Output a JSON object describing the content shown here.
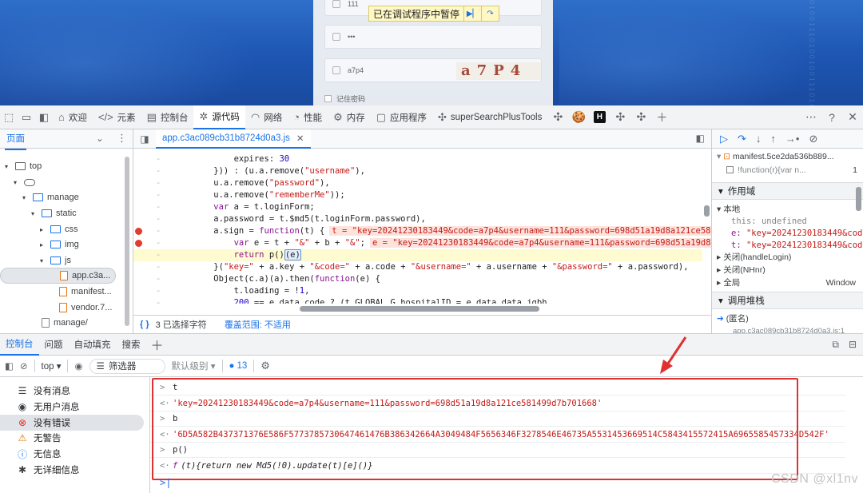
{
  "preview": {
    "username_value": "111",
    "password_value": "•••",
    "captcha_value": "a7p4",
    "captcha_image_text": "a7P4",
    "remember_label": "记住密码",
    "paused_banner": "已在调试程序中暂停"
  },
  "devtools_tabs": [
    {
      "label": "欢迎",
      "icon": "home-icon"
    },
    {
      "label": "元素",
      "icon": "code-tag-icon"
    },
    {
      "label": "控制台",
      "icon": "console-icon"
    },
    {
      "label": "源代码",
      "icon": "bug-icon",
      "active": true
    },
    {
      "label": "网络",
      "icon": "wifi-icon"
    },
    {
      "label": "性能",
      "icon": "gauge-icon"
    },
    {
      "label": "内存",
      "icon": "memory-icon"
    },
    {
      "label": "应用程序",
      "icon": "app-icon"
    },
    {
      "label": "superSearchPlusTools",
      "icon": "extension-icon"
    }
  ],
  "navigator": {
    "tab": "页面",
    "tree": [
      {
        "label": "top",
        "depth": 0
      },
      {
        "label": "",
        "depth": 1
      },
      {
        "label": "manage",
        "depth": 2
      },
      {
        "label": "static",
        "depth": 3
      },
      {
        "label": "css",
        "depth": 4
      },
      {
        "label": "img",
        "depth": 4
      },
      {
        "label": "js",
        "depth": 4
      },
      {
        "label": "app.c3a...",
        "depth": 5
      },
      {
        "label": "manifest...",
        "depth": 5
      },
      {
        "label": "vendor.7...",
        "depth": 5
      },
      {
        "label": "manage/",
        "depth": 3
      }
    ]
  },
  "editor": {
    "file_tab": "app.c3ac089cb31b8724d0a3.js",
    "status_selected": "3 已选择字符",
    "status_coverage": "覆盖范围: 不适用",
    "lines": [
      {
        "code": "        expires: 30"
      },
      {
        "code": "    })) : (u.a.remove(\"username\"),"
      },
      {
        "code": "    u.a.remove(\"password\"),"
      },
      {
        "code": "    u.a.remove(\"rememberMe\"));"
      },
      {
        "code": "    var a = t.loginForm;"
      },
      {
        "code": "    a.password = t.$md5(t.loginForm.password),"
      },
      {
        "code": "    a.sign = function(t) {",
        "inline": "t = \"key=20241230183449&code=a7p4&username=111&password=698d51a19d8a121ce581499"
      },
      {
        "code": "        var e = t + \"&\" + b + \"&\";",
        "inline": "e = \"key=20241230183449&code=a7p4&username=111&password=698d51a19d8a121"
      },
      {
        "code": "        return p()(e)"
      },
      {
        "code": "    }(\"key=\" + a.key + \"&code=\" + a.code + \"&username=\" + a.username + \"&password=\" + a.password),"
      },
      {
        "code": "    Object(c.a)(a).then(function(e) {"
      },
      {
        "code": "        t.loading = !1,"
      },
      {
        "code": "        200 == e.data.code ? (t.GLOBAL.G hospitalID = e.data.data.jgbh,"
      }
    ]
  },
  "debugger": {
    "callstack_top_file": "manifest.5ce2da536b889...",
    "callstack_top_fn": "!function(r){var n...",
    "callstack_top_line": "1",
    "scope_title": "作用域",
    "local_label": "本地",
    "this_label": "this:",
    "this_value": "undefined",
    "e_label": "e:",
    "e_value": "\"key=20241230183449&cod",
    "t_label": "t:",
    "t_value": "\"key=20241230183449&cod",
    "closure1": "关闭(handleLogin)",
    "closure2": "关闭(NHnr)",
    "global_label": "全局",
    "global_value": "Window",
    "callstack_title": "调用堆栈",
    "frame0": "(匿名)",
    "frame0_file": "app.c3ac089cb31b8724d0a3.js:1"
  },
  "drawer": {
    "tabs": [
      "控制台",
      "问题",
      "自动填充",
      "搜索"
    ],
    "context": "top",
    "filter_placeholder": "筛选器",
    "levels": "默认级别",
    "message_count": "13"
  },
  "console_sidebar": [
    {
      "label": "没有消息",
      "icon": "list-icon"
    },
    {
      "label": "无用户消息",
      "icon": "user-icon"
    },
    {
      "label": "没有错误",
      "icon": "error-icon",
      "selected": true
    },
    {
      "label": "无警告",
      "icon": "warning-icon"
    },
    {
      "label": "无信息",
      "icon": "info-icon"
    },
    {
      "label": "无详细信息",
      "icon": "verbose-icon"
    }
  ],
  "console_output": [
    {
      "kind": "in",
      "text": "t"
    },
    {
      "kind": "out",
      "text": "'key=20241230183449&code=a7p4&username=111&password=698d51a19d8a121ce581499d7b701668'"
    },
    {
      "kind": "in",
      "text": "b"
    },
    {
      "kind": "out",
      "text": "'6D5A582B437371376E586F5773785730647461476B386342664A3049484F5656346F3278546E46735A5531453669514C5843415572415A6965585457334D542F'"
    },
    {
      "kind": "in",
      "text": "p()"
    },
    {
      "kind": "out_fn",
      "f": "f",
      "text": "(t){return new Md5(!0).update(t)[e]()}"
    }
  ],
  "watermark": "CSDN @xl1nv",
  "colors": {
    "accent": "#1a73e8",
    "breakpoint": "#e33b2e",
    "highlight_box": "#e03131"
  }
}
